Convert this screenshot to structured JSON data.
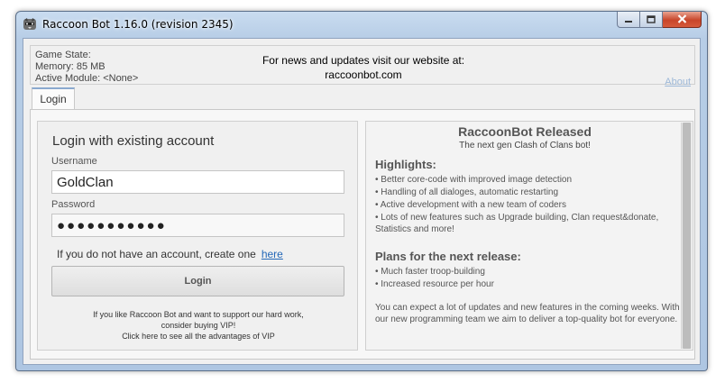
{
  "window": {
    "title": "Raccoon Bot 1.16.0 (revision 2345)",
    "icon": "raccoon-icon",
    "caption_buttons": [
      "minimize-icon",
      "maximize-icon",
      "close-icon"
    ]
  },
  "status": {
    "game_state": "Game State:",
    "memory": "Memory: 85 MB",
    "active_module": "Active Module: <None>"
  },
  "news_banner": {
    "line1": "For news and updates visit our website at:",
    "line2": "raccoonbot.com"
  },
  "about_link": "About",
  "tabs": [
    {
      "label": "Login"
    }
  ],
  "login": {
    "heading": "Login with existing account",
    "username_label": "Username",
    "username_value": "GoldClan",
    "password_label": "Password",
    "password_value": "●●●●●●●●●●●",
    "no_account_text": "If you do not have an account, create one",
    "here_link": "here",
    "login_button": "Login",
    "vip_line1": "If you like Raccoon Bot and want to support our hard work,",
    "vip_line2": "consider buying VIP!",
    "vip_line3": "Click here to see all the advantages of VIP"
  },
  "release": {
    "title": "RaccoonBot Released",
    "subtitle": "The next gen Clash of Clans bot!",
    "highlights_heading": "Highlights:",
    "highlights": [
      "• Better core-code with improved image detection",
      "• Handling of all dialoges, automatic restarting",
      "• Active development with a new team of coders",
      "• Lots of new features such as Upgrade building, Clan request&donate, Statistics and more!"
    ],
    "plans_heading": "Plans for the next release:",
    "plans": [
      "• Much faster troop-building",
      "• Increased resource per hour"
    ],
    "closing": "You can expect a lot of updates and new features in the coming weeks. With our new programming team we aim to deliver a top-quality bot for everyone."
  },
  "colors": {
    "link": "#2468b8",
    "about_link": "#9db8d8",
    "titlebar": "#b7cde6",
    "close_button": "#c8452a"
  }
}
